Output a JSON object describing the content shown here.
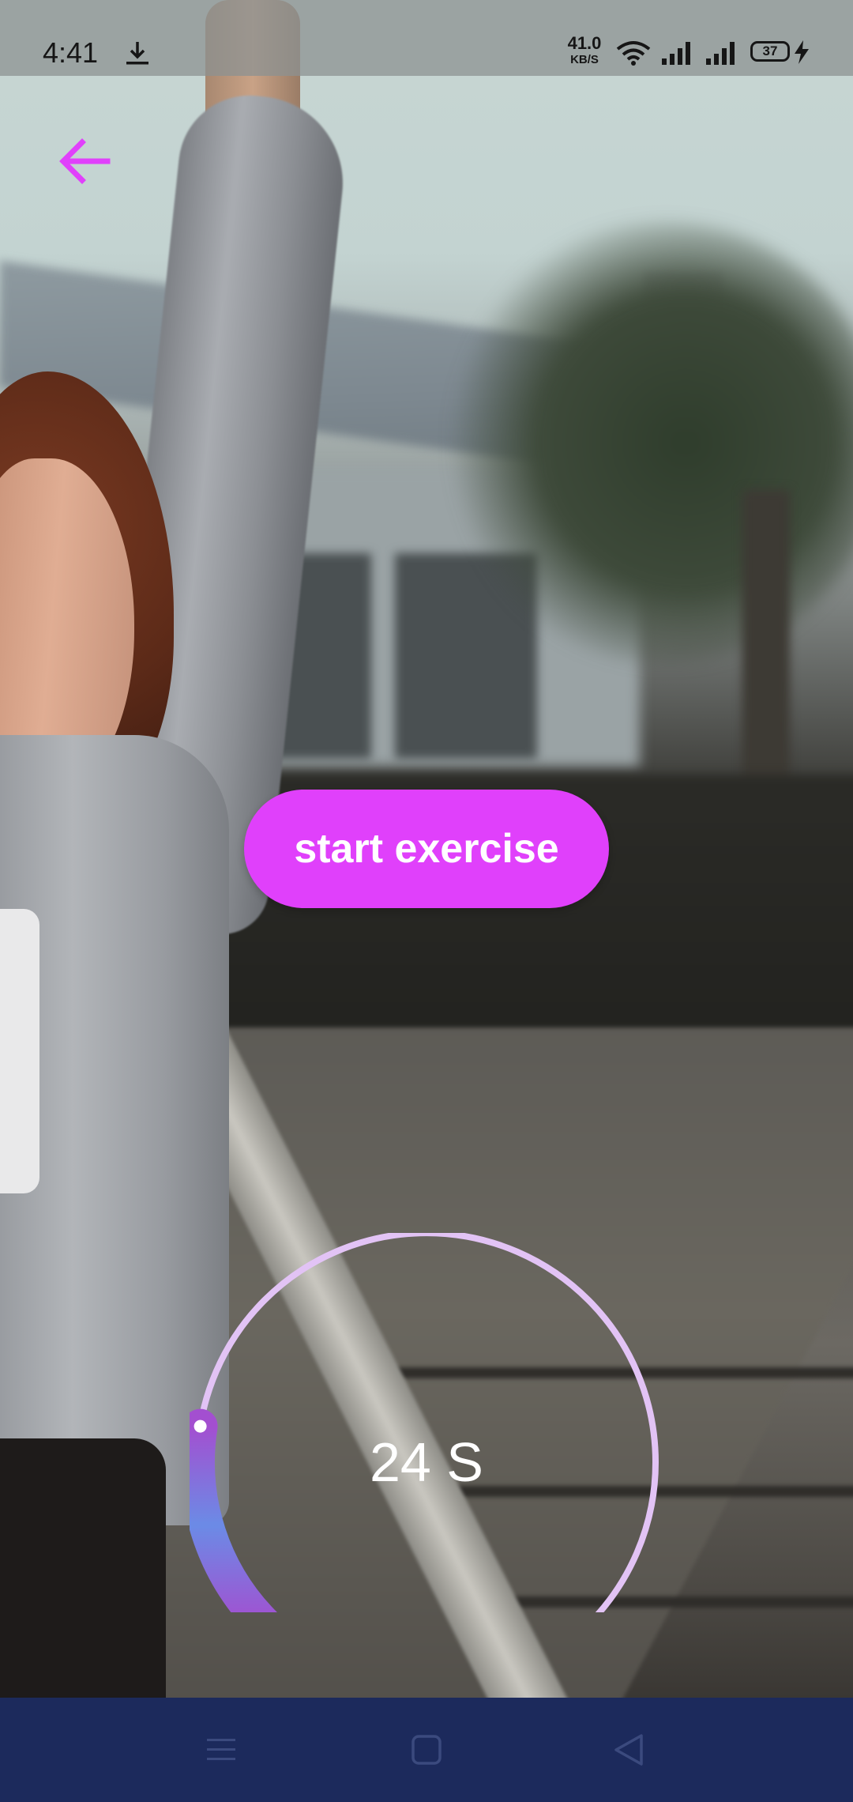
{
  "status_bar": {
    "time": "4:41",
    "download_icon": "download-icon",
    "net_speed_value": "41.0",
    "net_speed_unit": "KB/S",
    "wifi_icon": "wifi-icon",
    "signal_icons": [
      "signal-bars-icon",
      "signal-bars-icon"
    ],
    "battery_level": "37",
    "charging_icon": "lightning-bolt-icon"
  },
  "header": {
    "back_icon": "arrow-left-icon",
    "back_color": "#e040fb"
  },
  "main": {
    "start_button_label": "start exercise",
    "accent_color": "#e040fb",
    "timer": {
      "label": "24 S",
      "seconds_remaining": 24,
      "progress_fraction": 0.2,
      "track_color": "#e2c3f5",
      "progress_gradient": [
        "#a34fd0",
        "#6b8be6",
        "#a34fd0"
      ]
    }
  },
  "nav_bar": {
    "background": "#1c2a5c",
    "buttons": [
      "menu-lines-icon",
      "square-home-icon",
      "triangle-back-icon"
    ]
  }
}
